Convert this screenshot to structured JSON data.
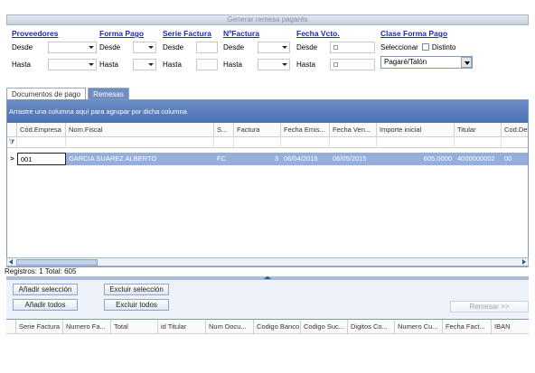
{
  "window": {
    "title": "Generar remesa pagarés"
  },
  "filters": {
    "proveedores": {
      "title": "Proveedores",
      "desde": "Desde",
      "hasta": "Hasta"
    },
    "forma_pago": {
      "title": "Forma Pago",
      "desde": "Desde",
      "hasta": "Hasta"
    },
    "serie_factura": {
      "title": "Serie Factura",
      "desde": "Desde",
      "hasta": "Hasta"
    },
    "n_factura": {
      "title": "NºFactura",
      "desde": "Desde",
      "hasta": "Hasta"
    },
    "fecha_vcto": {
      "title": "Fecha Vcto.",
      "desde": "Desde",
      "hasta": "Hasta"
    },
    "clase_forma_pago": {
      "title": "Clase Forma Pago",
      "seleccionar": "Seleccionar",
      "distinto": "Distinto",
      "selected": "Pagaré/Talón"
    }
  },
  "tabs": [
    {
      "label": "Documentos de pago"
    },
    {
      "label": "Remesas"
    }
  ],
  "grid1": {
    "group_hint": "Arrastre una columna aquí para agrupar por dicha columna",
    "headers": [
      "Cód.Empresa",
      "Nom.Fiscal",
      "S...",
      "Factura",
      "Fecha Emis...",
      "Fecha Ven...",
      "Importe inicial",
      "Titular",
      "Cod.Dele"
    ],
    "filter_icon": "filter-icon",
    "rows": [
      {
        "indicator": ">",
        "cod_empresa": "001",
        "nom_fiscal": "GARCIA SUAREZ ALBERTO",
        "serie": "FC",
        "factura": "3",
        "fecha_emision": "06/04/2015",
        "fecha_vencimiento": "06/05/2015",
        "importe_inicial": "605,0000",
        "titular": "4000000002",
        "cod_dele": "00"
      }
    ]
  },
  "status": {
    "text": "Registros: 1 Total: 605"
  },
  "actions": {
    "anadir_seleccion": "Añadir selección",
    "anadir_todos": "Añadir todos",
    "excluir_seleccion": "Excluir selección",
    "excluir_todos": "Excluir todos",
    "remesar": "Remesar >>"
  },
  "grid2": {
    "headers": [
      "Serie Factura",
      "Numero Fa...",
      "Total",
      "id Titular",
      "Num Docu...",
      "Codigo Banco",
      "Codigo Suc...",
      "Digitos Co...",
      "Numero Cu...",
      "Fecha Fact...",
      "IBAN"
    ]
  }
}
